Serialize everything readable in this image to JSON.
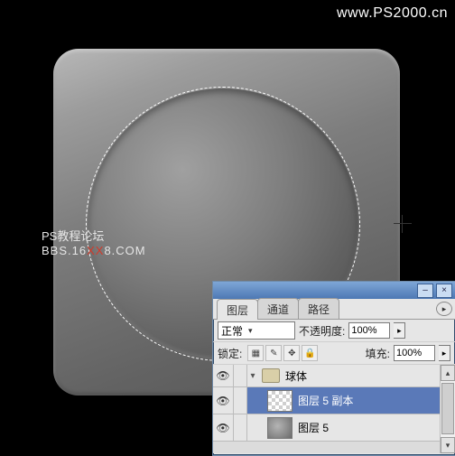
{
  "watermark": {
    "url": "www.PS2000.cn",
    "forum_line1": "PS教程论坛",
    "forum_line2_a": "BBS.16",
    "forum_line2_b": "XX",
    "forum_line2_c": "8.COM"
  },
  "panel": {
    "tabs": {
      "layers": "图层",
      "channels": "通道",
      "paths": "路径"
    },
    "blend": {
      "value": "正常"
    },
    "opacity": {
      "label": "不透明度:",
      "value": "100%"
    },
    "lock": {
      "label": "锁定:"
    },
    "fill": {
      "label": "填充:",
      "value": "100%"
    },
    "icons": {
      "trans": "▦",
      "brush": "✎",
      "move": "✥",
      "lockall": "🔒"
    },
    "group": {
      "name": "球体"
    },
    "layer_a": {
      "name": "图层 5 副本"
    },
    "layer_b": {
      "name": "图层 5"
    }
  }
}
